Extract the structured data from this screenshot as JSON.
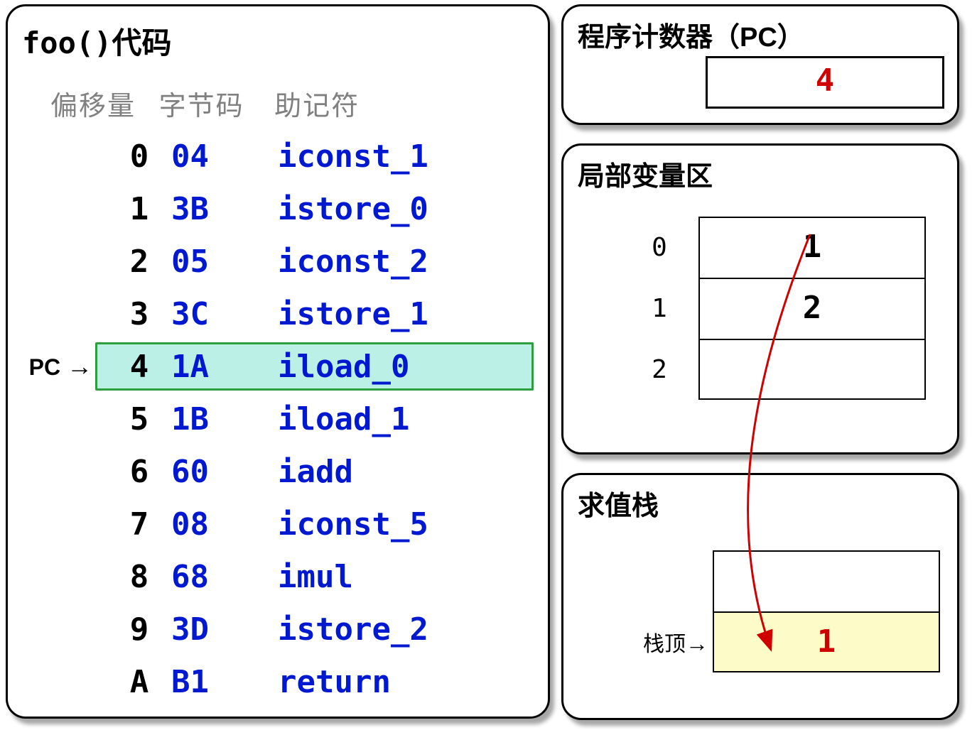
{
  "code": {
    "title_func": "foo()",
    "title_suffix": "代码",
    "headers": {
      "offset": "偏移量",
      "bytecode": "字节码",
      "mnemonic": "助记符"
    },
    "pc_label": "PC",
    "rows": [
      {
        "offset": "0",
        "byte": "04",
        "mnem": "iconst_1",
        "current": false
      },
      {
        "offset": "1",
        "byte": "3B",
        "mnem": "istore_0",
        "current": false
      },
      {
        "offset": "2",
        "byte": "05",
        "mnem": "iconst_2",
        "current": false
      },
      {
        "offset": "3",
        "byte": "3C",
        "mnem": "istore_1",
        "current": false
      },
      {
        "offset": "4",
        "byte": "1A",
        "mnem": "iload_0",
        "current": true
      },
      {
        "offset": "5",
        "byte": "1B",
        "mnem": "iload_1",
        "current": false
      },
      {
        "offset": "6",
        "byte": "60",
        "mnem": "iadd",
        "current": false
      },
      {
        "offset": "7",
        "byte": "08",
        "mnem": "iconst_5",
        "current": false
      },
      {
        "offset": "8",
        "byte": "68",
        "mnem": "imul",
        "current": false
      },
      {
        "offset": "9",
        "byte": "3D",
        "mnem": "istore_2",
        "current": false
      },
      {
        "offset": "A",
        "byte": "B1",
        "mnem": "return",
        "current": false
      }
    ]
  },
  "pc": {
    "title": "程序计数器（PC）",
    "value": "4"
  },
  "locals": {
    "title": "局部变量区",
    "slots": [
      {
        "index": "0",
        "value": "1"
      },
      {
        "index": "1",
        "value": "2"
      },
      {
        "index": "2",
        "value": ""
      }
    ]
  },
  "stack": {
    "title": "求值栈",
    "top_label": "栈顶",
    "slots": [
      {
        "value": "",
        "is_top": false
      },
      {
        "value": "1",
        "is_top": true
      }
    ]
  }
}
